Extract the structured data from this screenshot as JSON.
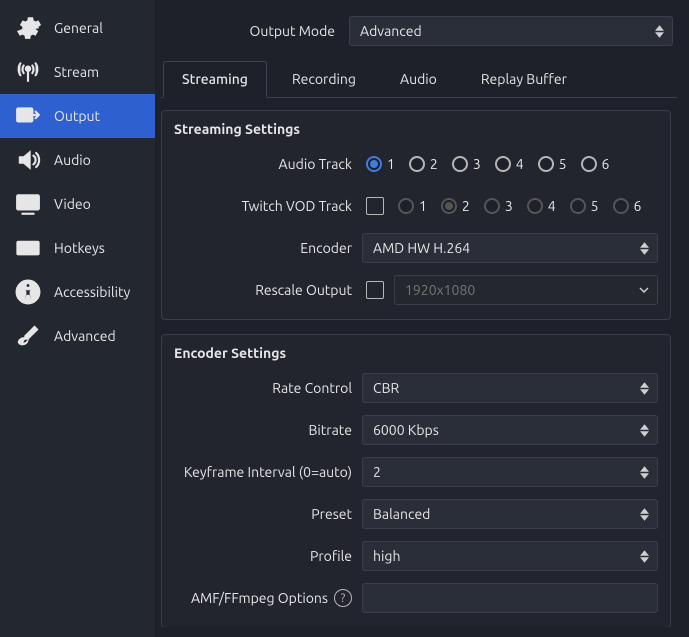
{
  "sidebar": {
    "items": [
      {
        "label": "General",
        "icon": "gear-icon"
      },
      {
        "label": "Stream",
        "icon": "broadcast-icon"
      },
      {
        "label": "Output",
        "icon": "output-icon"
      },
      {
        "label": "Audio",
        "icon": "speaker-icon"
      },
      {
        "label": "Video",
        "icon": "monitor-icon"
      },
      {
        "label": "Hotkeys",
        "icon": "keyboard-icon"
      },
      {
        "label": "Accessibility",
        "icon": "accessibility-icon"
      },
      {
        "label": "Advanced",
        "icon": "tools-icon"
      }
    ],
    "selected": 2
  },
  "output": {
    "mode_label": "Output Mode",
    "mode_value": "Advanced",
    "tabs": [
      "Streaming",
      "Recording",
      "Audio",
      "Replay Buffer"
    ],
    "active_tab": 0,
    "streaming": {
      "title": "Streaming Settings",
      "audio_track_label": "Audio Track",
      "audio_track_options": [
        "1",
        "2",
        "3",
        "4",
        "5",
        "6"
      ],
      "audio_track_selected": 0,
      "vod_track_label": "Twitch VOD Track",
      "vod_track_enabled": false,
      "vod_track_options": [
        "1",
        "2",
        "3",
        "4",
        "5",
        "6"
      ],
      "vod_track_selected": 1,
      "encoder_label": "Encoder",
      "encoder_value": "AMD HW H.264",
      "rescale_label": "Rescale Output",
      "rescale_enabled": false,
      "rescale_value": "1920x1080"
    },
    "encoder": {
      "title": "Encoder Settings",
      "rate_control_label": "Rate Control",
      "rate_control_value": "CBR",
      "bitrate_label": "Bitrate",
      "bitrate_value": "6000 Kbps",
      "keyframe_label": "Keyframe Interval (0=auto)",
      "keyframe_value": "2",
      "preset_label": "Preset",
      "preset_value": "Balanced",
      "profile_label": "Profile",
      "profile_value": "high",
      "amf_label": "AMF/FFmpeg Options",
      "amf_value": ""
    }
  }
}
